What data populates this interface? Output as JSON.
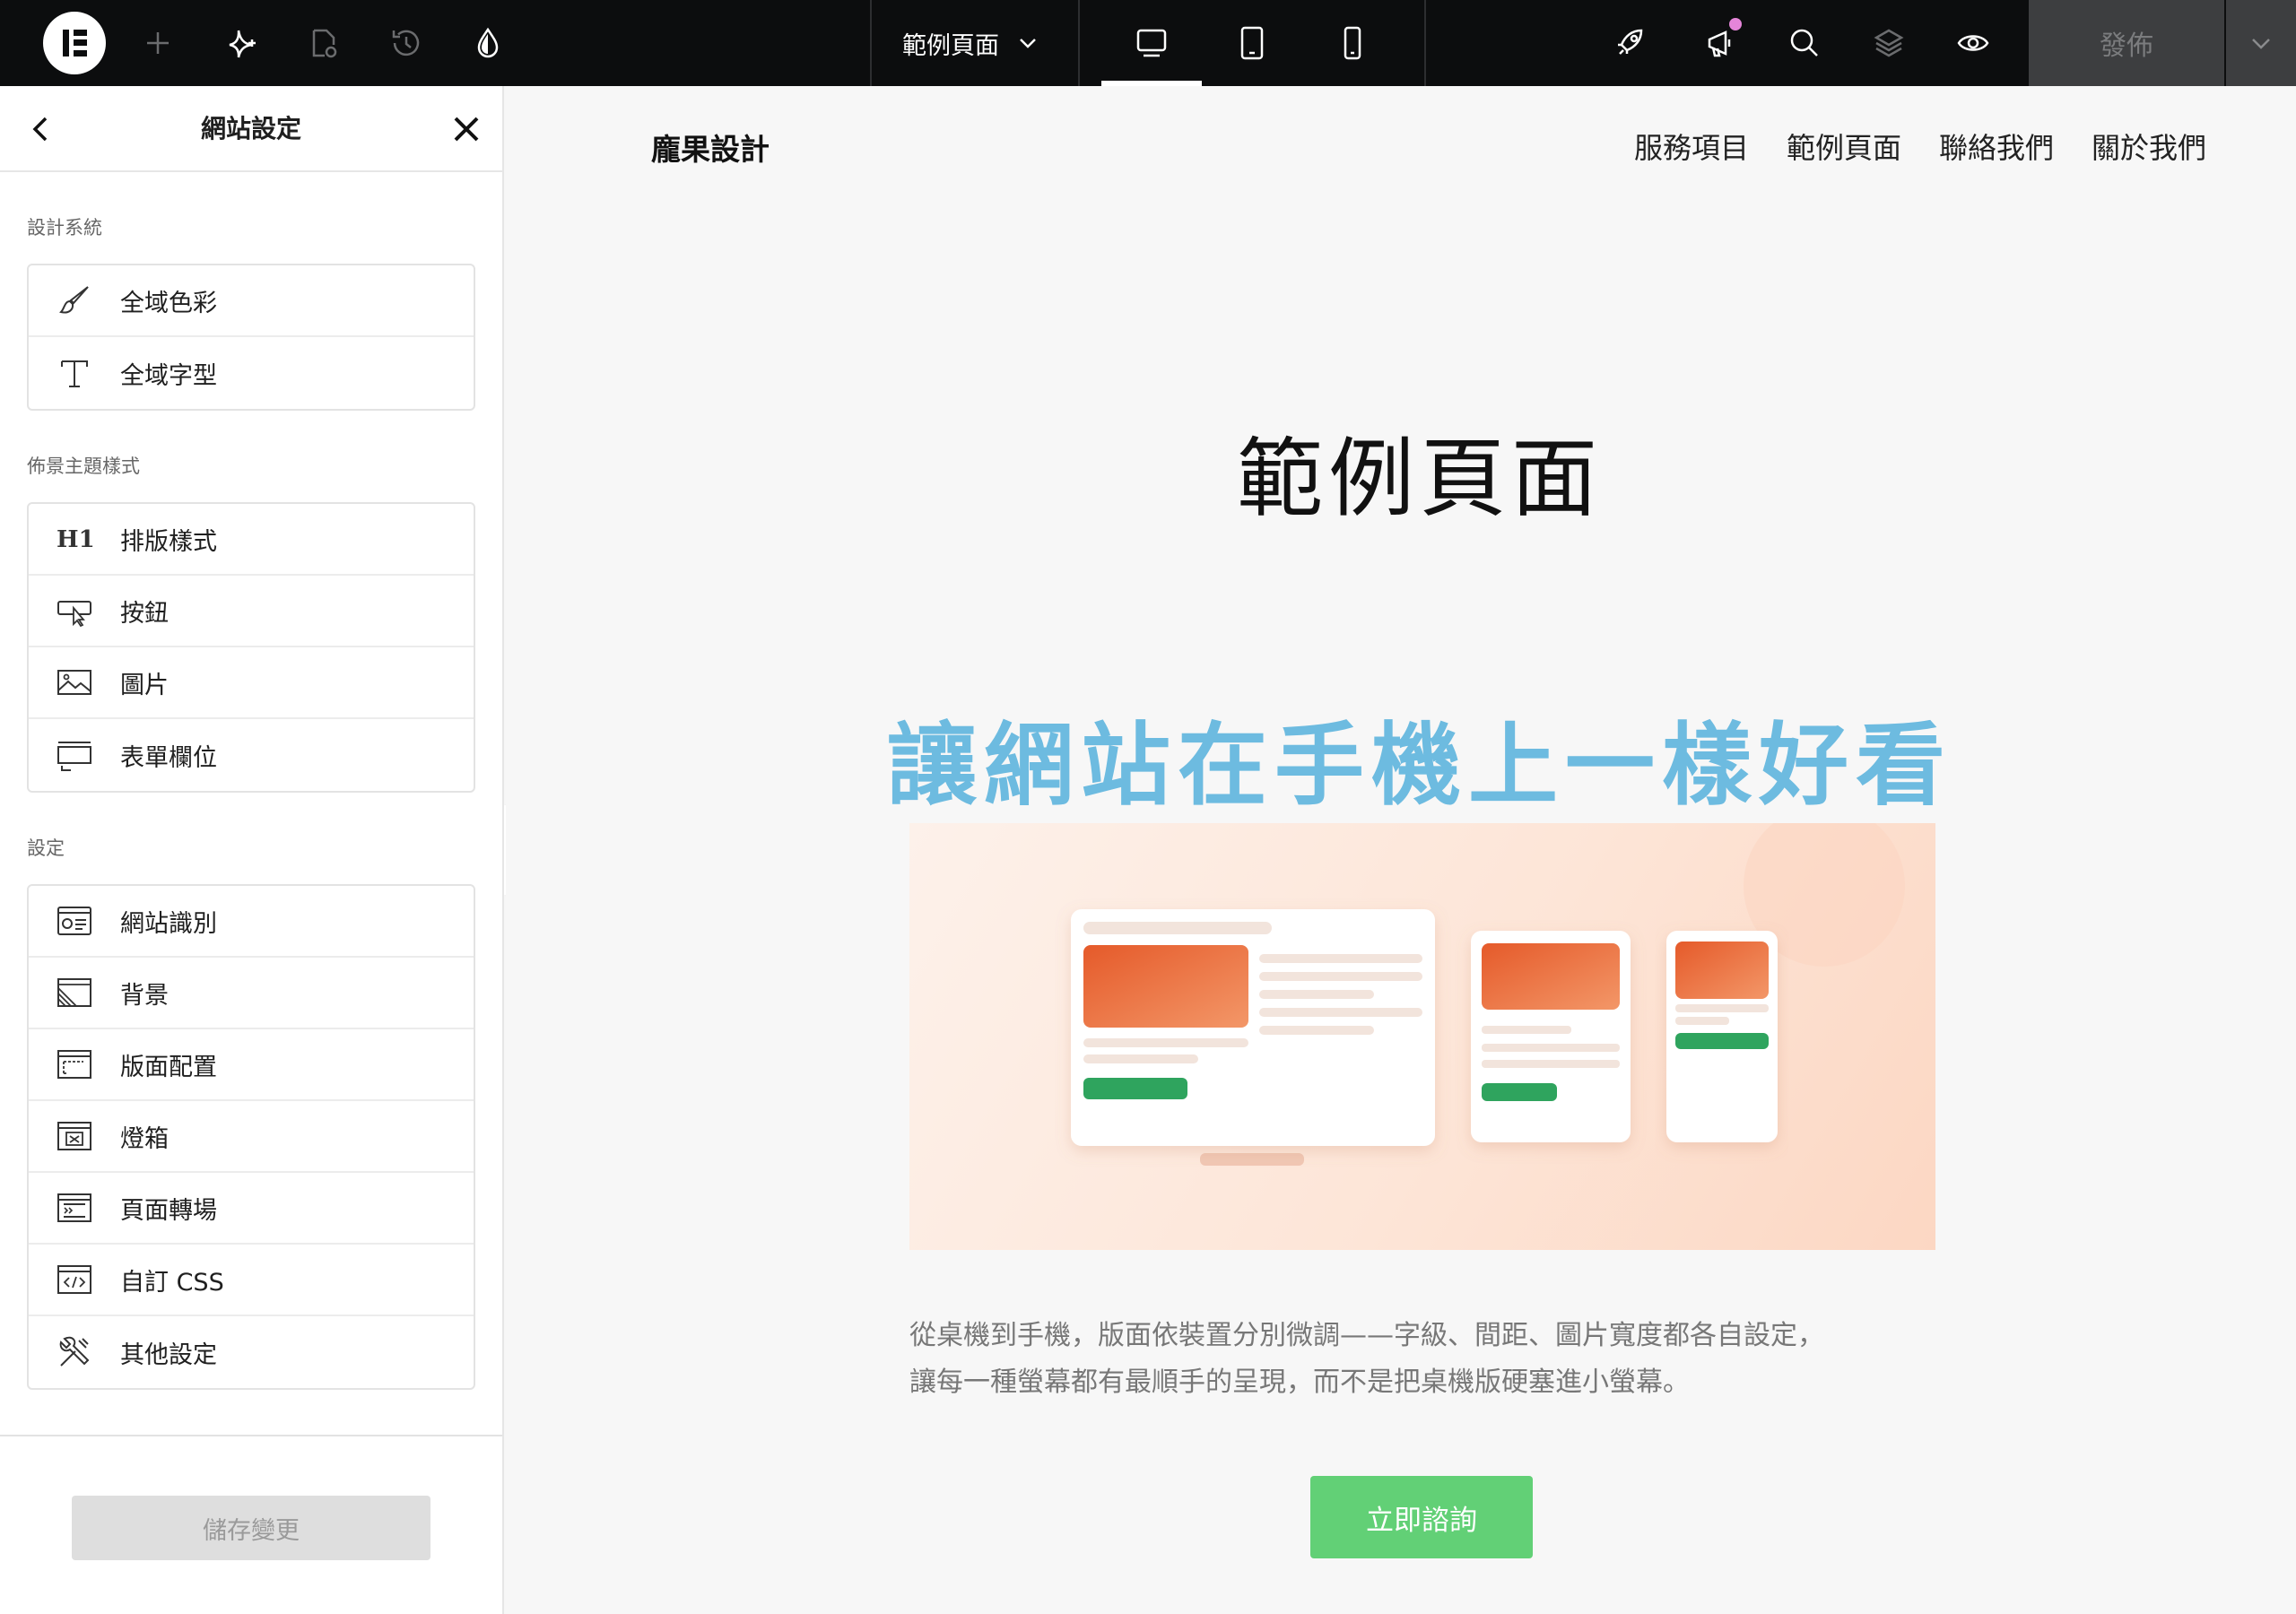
{
  "toolbar": {
    "page_name": "範例頁面",
    "publish_label": "發佈",
    "icons": [
      "elementor-logo",
      "plus-icon",
      "ai-sparkle-icon",
      "page-settings-icon",
      "history-icon",
      "theme-style-icon",
      "chevron-down-icon",
      "desktop-icon",
      "tablet-icon",
      "mobile-icon",
      "rocket-icon",
      "announcement-icon",
      "search-icon",
      "layers-icon",
      "eye-icon",
      "chevron-down-icon"
    ],
    "active_device": "desktop"
  },
  "panel": {
    "title": "網站設定",
    "sections": [
      {
        "label": "設計系統",
        "items": [
          {
            "label": "全域色彩",
            "icon": "brush-icon"
          },
          {
            "label": "全域字型",
            "icon": "typography-icon"
          }
        ]
      },
      {
        "label": "佈景主題樣式",
        "items": [
          {
            "label": "排版樣式",
            "icon": "heading-h1-icon"
          },
          {
            "label": "按鈕",
            "icon": "button-cursor-icon"
          },
          {
            "label": "圖片",
            "icon": "image-icon"
          },
          {
            "label": "表單欄位",
            "icon": "form-field-icon"
          }
        ]
      },
      {
        "label": "設定",
        "items": [
          {
            "label": "網站識別",
            "icon": "site-identity-icon"
          },
          {
            "label": "背景",
            "icon": "background-icon"
          },
          {
            "label": "版面配置",
            "icon": "layout-icon"
          },
          {
            "label": "燈箱",
            "icon": "lightbox-icon"
          },
          {
            "label": "頁面轉場",
            "icon": "page-transition-icon"
          },
          {
            "label": "自訂 CSS",
            "icon": "custom-css-icon"
          },
          {
            "label": "其他設定",
            "icon": "tools-icon"
          }
        ]
      }
    ],
    "save_label": "儲存變更"
  },
  "site": {
    "brand": "龐果設計",
    "nav": [
      "服務項目",
      "範例頁面",
      "聯絡我們",
      "關於我們"
    ],
    "page_title": "範例頁面",
    "hero_heading": "讓網站在手機上一樣好看",
    "hero_image": "responsive-devices-illustration",
    "body_lines": [
      "從桌機到手機，版面依裝置分別微調——字級、間距、圖片寬度都各自設定，",
      "讓每一種螢幕都有最順手的呈現，而不是把桌機版硬塞進小螢幕。"
    ],
    "cta_label": "立即諮詢"
  },
  "colors": {
    "topbar": "#0c0d0e",
    "publish_bg": "#3d3e40",
    "notification_dot": "#e585d9",
    "hero_heading": "#6dbbe0",
    "cta": "#62d076",
    "illustration_orange": "#e8642f",
    "illustration_green": "#2fa45e"
  }
}
